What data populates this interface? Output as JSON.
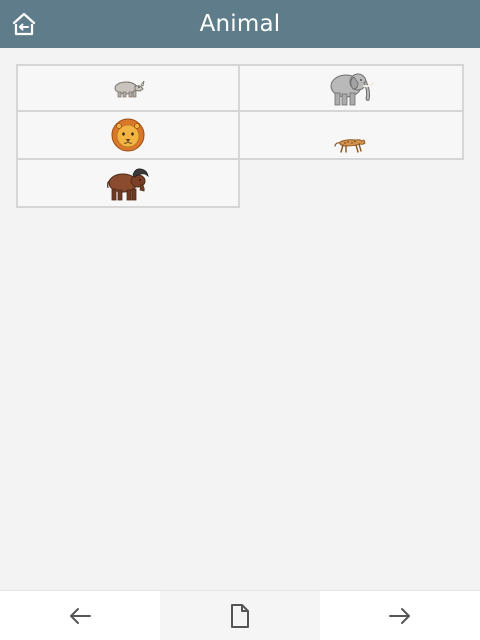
{
  "header": {
    "title": "Animal",
    "home_icon": "home-back-icon"
  },
  "grid": {
    "items": [
      {
        "icon": "rhinoceros-icon"
      },
      {
        "icon": "elephant-icon"
      },
      {
        "icon": "lion-icon"
      },
      {
        "icon": "cheetah-icon"
      },
      {
        "icon": "buffalo-icon"
      }
    ]
  },
  "bottom_bar": {
    "back_icon": "arrow-left-icon",
    "page_icon": "document-icon",
    "forward_icon": "arrow-right-icon"
  },
  "colors": {
    "header_bg": "#5f7c8a",
    "page_bg": "#f3f3f3",
    "cell_border": "#d6d6d6"
  }
}
